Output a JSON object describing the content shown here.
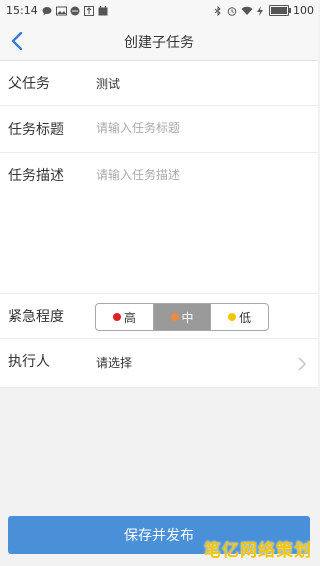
{
  "status_bar": {
    "time": "15:14",
    "battery": "100",
    "icons": [
      "chat-icon",
      "image-icon",
      "message-icon",
      "usb-icon",
      "calendar-icon",
      "bluetooth-icon",
      "alarm-icon",
      "wifi-icon",
      "charging-icon",
      "battery-icon"
    ]
  },
  "nav": {
    "title": "创建子任务",
    "back_icon": "chevron-left-icon"
  },
  "form": {
    "parent_task": {
      "label": "父任务",
      "value": "测试"
    },
    "task_title": {
      "label": "任务标题",
      "placeholder": "请输入任务标题"
    },
    "task_desc": {
      "label": "任务描述",
      "placeholder": "请输入任务描述"
    },
    "urgency": {
      "label": "紧急程度",
      "options": [
        {
          "label": "高",
          "color": "#e02020"
        },
        {
          "label": "中",
          "color": "#f08a3c"
        },
        {
          "label": "低",
          "color": "#f5c400"
        }
      ],
      "selected": "中"
    },
    "assignee": {
      "label": "执行人",
      "value": "请选择"
    }
  },
  "submit": {
    "label": "保存并发布"
  },
  "colors": {
    "primary": "#4a90d9",
    "selected_segment": "#9a9a9a"
  },
  "watermark": "笔亿网络策划"
}
